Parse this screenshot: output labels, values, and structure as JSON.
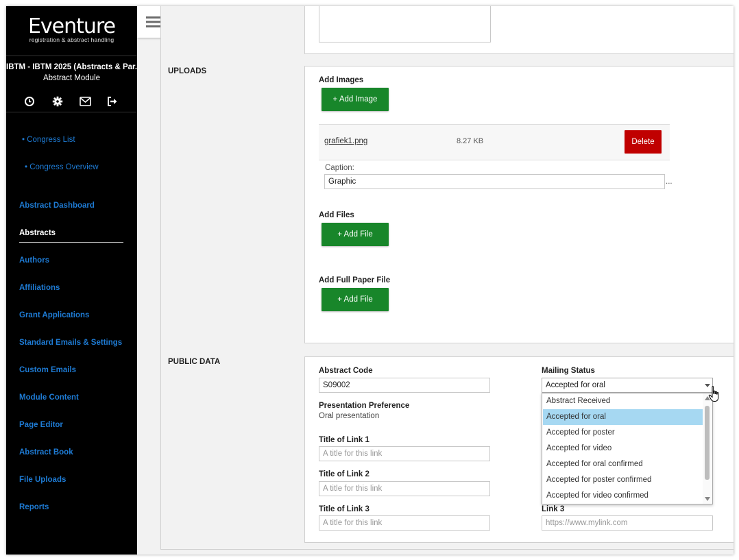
{
  "brand": {
    "name": "Eventure",
    "tagline": "registration & abstract handling"
  },
  "sidebar": {
    "congress_title": "IBTM - IBTM 2025 (Abstracts & Par...",
    "module": "Abstract Module",
    "icons": [
      "clock-icon",
      "gear-icon",
      "mail-icon",
      "logout-icon"
    ],
    "sub_links": [
      "• Congress List",
      "• Congress Overview"
    ],
    "items": [
      {
        "label": "Abstract Dashboard"
      },
      {
        "label": "Abstracts",
        "active": true
      },
      {
        "label": "Authors"
      },
      {
        "label": "Affiliations"
      },
      {
        "label": "Grant Applications"
      },
      {
        "label": "Standard Emails & Settings"
      },
      {
        "label": "Custom Emails"
      },
      {
        "label": "Module Content"
      },
      {
        "label": "Page Editor"
      },
      {
        "label": "Abstract Book"
      },
      {
        "label": "File Uploads"
      },
      {
        "label": "Reports"
      }
    ]
  },
  "toolbar": {
    "menu_icon": "hamburger-icon",
    "help_icon": "help-icon"
  },
  "uploads": {
    "section_label": "UPLOADS",
    "add_images_label": "Add Images",
    "add_image_button": "+ Add Image",
    "file": {
      "name": "grafiek1.png",
      "size": "8.27 KB",
      "delete_label": "Delete"
    },
    "caption_label": "Caption:",
    "caption_value": "Graphic",
    "caption_ellipsis": "...",
    "add_files_label": "Add Files",
    "add_file_button": "+ Add File",
    "add_full_paper_label": "Add Full Paper File",
    "add_full_paper_button": "+ Add File"
  },
  "public_data": {
    "section_label": "PUBLIC DATA",
    "abstract_code_label": "Abstract Code",
    "abstract_code_value": "S09002",
    "presentation_pref_label": "Presentation Preference",
    "presentation_pref_value": "Oral presentation",
    "title_link1_label": "Title of Link 1",
    "title_link1_placeholder": "A title for this link",
    "title_link2_label": "Title of Link 2",
    "title_link2_placeholder": "A title for this link",
    "title_link3_label": "Title of Link 3",
    "title_link3_placeholder": "A title for this link",
    "mailing_status_label": "Mailing Status",
    "mailing_status_value": "Accepted for oral",
    "mailing_status_options": [
      "Abstract Received",
      "Accepted for oral",
      "Accepted for poster",
      "Accepted for video",
      "Accepted for oral confirmed",
      "Accepted for poster confirmed",
      "Accepted for video confirmed"
    ],
    "link3_label": "Link 3",
    "link3_placeholder": "https://www.mylink.com"
  },
  "colors": {
    "sidebar_bg": "#000000",
    "link_blue": "#1e7bd4",
    "green_button": "#18862a",
    "delete_red": "#c00000",
    "selected_option": "#a6d8f2",
    "help_blue": "#1372c9"
  }
}
